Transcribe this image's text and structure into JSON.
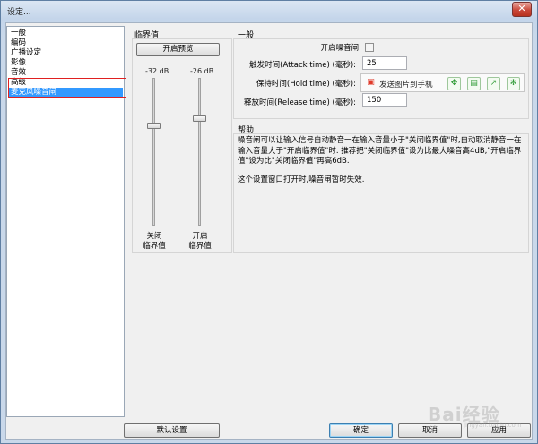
{
  "window": {
    "title": "设定...",
    "close_glyph": "✕"
  },
  "sidebar": {
    "items": [
      {
        "label": "一般"
      },
      {
        "label": "编码"
      },
      {
        "label": "广播设定"
      },
      {
        "label": "影像"
      },
      {
        "label": "音效"
      },
      {
        "label": "高级"
      },
      {
        "label": "麦克风噪音闸"
      }
    ],
    "selected_index": 6
  },
  "threshold": {
    "group_label": "临界值",
    "preview_button": "开启预览",
    "close_db": "-32 dB",
    "open_db": "-26 dB",
    "close_caption": "关闭\n临界值",
    "open_caption": "开启\n临界值"
  },
  "general": {
    "group_label": "一般",
    "enable_label": "开启噪音闸:",
    "enable_checked": false,
    "attack_label": "触发时间(Attack time) (毫秒):",
    "attack_value": "25",
    "hold_label": "保持时间(Hold time) (毫秒):",
    "release_label": "释放时间(Release time) (毫秒):",
    "release_value": "150"
  },
  "popup_toolbar": {
    "send_label": "发送图片到手机",
    "icons": [
      "send-image-icon",
      "expand-icon",
      "save-icon",
      "share-icon",
      "settings-icon"
    ]
  },
  "help": {
    "group_label": "帮助",
    "paragraph1": "噪音闸可以让输入信号自动静音一在输入音量小于\"关闭临界值\"时,自动取消静音一在输入音量大于\"开启临界值\"时. 推荐把\"关闭临界值\"设为比最大噪音高4dB,\"开启临界值\"设为比\"关闭临界值\"再高6dB.",
    "paragraph2": "这个设置窗口打开时,噪音闸暂时失效."
  },
  "buttons": {
    "defaults": "默认设置",
    "ok": "确定",
    "cancel": "取消",
    "apply": "应用"
  },
  "watermark": {
    "brand": "Bai经验",
    "url": "jingyan.baidu.com"
  },
  "colors": {
    "selection": "#3399ff",
    "highlight_box": "#e02020",
    "tool_green": "#2e9b35"
  }
}
